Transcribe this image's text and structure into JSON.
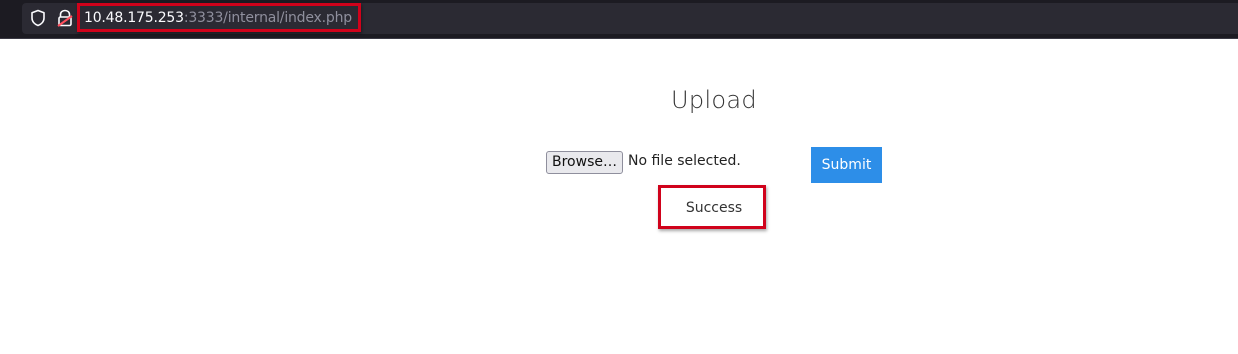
{
  "browser": {
    "url_host": "10.48.175.253",
    "url_path": ":3333/internal/index.php",
    "icons": [
      "shield-icon",
      "lock-warning-icon"
    ]
  },
  "page": {
    "title": "Upload",
    "file_input": {
      "button_label": "Browse…",
      "status_text": "No file selected."
    },
    "submit_label": "Submit",
    "message": "Success"
  },
  "colors": {
    "topbar_bg": "#1c1b22",
    "urlbar_bg": "#2b2a33",
    "submit_bg": "#2d8ee8",
    "highlight": "#d0021b"
  }
}
